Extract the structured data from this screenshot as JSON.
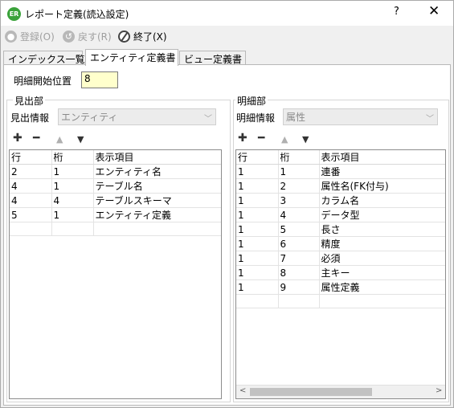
{
  "window": {
    "icon_text": "ER",
    "title": "レポート定義(読込設定)",
    "help": "?",
    "close": "✕"
  },
  "toolbar": {
    "register": "登録(O)",
    "revert": "戻す(R)",
    "exit": "終了(X)"
  },
  "tabs": [
    {
      "label": "インデックス一覧",
      "active": false
    },
    {
      "label": "エンティティ定義書",
      "active": true
    },
    {
      "label": "ビュー定義書",
      "active": false
    }
  ],
  "detail_start": {
    "label": "明細開始位置",
    "value": "8"
  },
  "header_section": {
    "title": "見出部",
    "info_label": "見出情報",
    "info_value": "エンティティ",
    "columns": [
      "行",
      "桁",
      "表示項目"
    ],
    "rows": [
      [
        "2",
        "1",
        "エンティティ名"
      ],
      [
        "4",
        "1",
        "テーブル名"
      ],
      [
        "4",
        "4",
        "テーブルスキーマ"
      ],
      [
        "5",
        "1",
        "エンティティ定義"
      ]
    ]
  },
  "detail_section": {
    "title": "明細部",
    "info_label": "明細情報",
    "info_value": "属性",
    "columns": [
      "行",
      "桁",
      "表示項目"
    ],
    "rows": [
      [
        "1",
        "1",
        "連番"
      ],
      [
        "1",
        "2",
        "属性名(FK付与)"
      ],
      [
        "1",
        "3",
        "カラム名"
      ],
      [
        "1",
        "4",
        "データ型"
      ],
      [
        "1",
        "5",
        "長さ"
      ],
      [
        "1",
        "6",
        "精度"
      ],
      [
        "1",
        "7",
        "必須"
      ],
      [
        "1",
        "8",
        "主キー"
      ],
      [
        "1",
        "9",
        "属性定義"
      ]
    ]
  },
  "icons": {
    "add": "plus-icon",
    "remove": "minus-icon",
    "up": "up-arrow-icon",
    "down": "down-arrow-icon"
  }
}
